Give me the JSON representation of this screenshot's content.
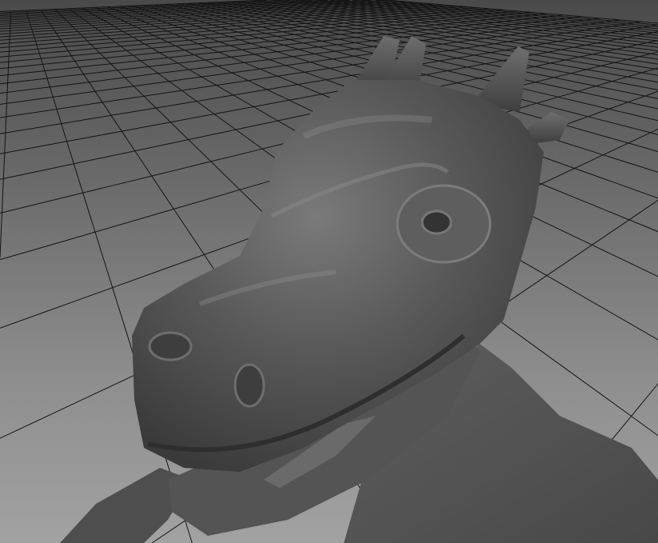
{
  "viewport": {
    "background_top": "#4a4a4a",
    "background_bottom": "#a2a2a2",
    "grid_color": "#141414",
    "model_color": "#5a5a5a"
  }
}
